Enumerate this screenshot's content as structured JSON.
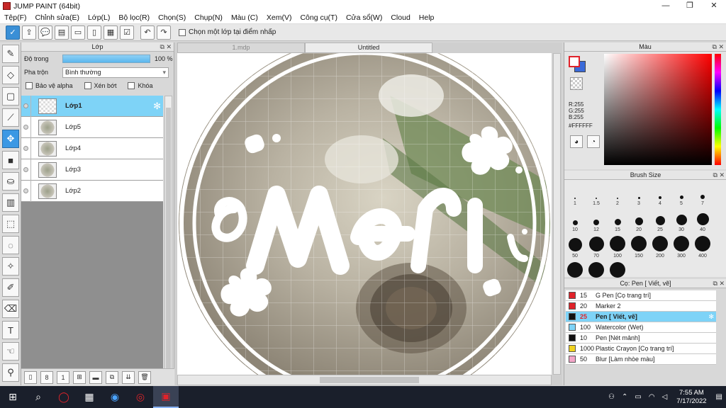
{
  "window": {
    "title": "JUMP PAINT (64bit)",
    "controls": [
      "—",
      "❐",
      "✕"
    ]
  },
  "menu": [
    "Tệp(F)",
    "Chỉnh sửa(E)",
    "Lớp(L)",
    "Bộ lọc(R)",
    "Chọn(S)",
    "Chụp(N)",
    "Màu (C)",
    "Xem(V)",
    "Công cụ(T)",
    "Cửa sổ(W)",
    "Cloud",
    "Help"
  ],
  "toolbar": {
    "select_label": "Chọn một lớp tại điểm nhấp"
  },
  "layer_panel": {
    "title": "Lớp",
    "opacity_label": "Độ trong",
    "opacity_value": "100 %",
    "opacity_fraction": 1.0,
    "blend_label": "Pha trộn",
    "blend_value": "Bình thường",
    "protect_alpha": "Bảo vệ alpha",
    "clip": "Xén bớt",
    "lock": "Khóa",
    "layers": [
      {
        "name": "Lớp1",
        "selected": true
      },
      {
        "name": "Lớp5",
        "selected": false
      },
      {
        "name": "Lớp4",
        "selected": false
      },
      {
        "name": "Lớp3",
        "selected": false
      },
      {
        "name": "Lớp2",
        "selected": false
      }
    ]
  },
  "tabs": [
    {
      "label": "1.mdp",
      "active": false
    },
    {
      "label": "Untitled",
      "active": true
    }
  ],
  "canvas": {
    "lettering": "Meri"
  },
  "color_panel": {
    "title": "Màu",
    "r": "R:255",
    "g": "G:255",
    "b": "B:255",
    "hex": "#FFFFFF",
    "foreground": "#ffffff",
    "background": "#3a6ad9"
  },
  "brush_size": {
    "title": "Brush Size",
    "sizes": [
      "1",
      "1.5",
      "2",
      "3",
      "4",
      "5",
      "7",
      "10",
      "12",
      "15",
      "20",
      "25",
      "30",
      "40",
      "50",
      "70",
      "100",
      "150",
      "200",
      "300",
      "400",
      "",
      "",
      ""
    ]
  },
  "pen_panel": {
    "title": "Cọ: Pen [ Viết, vẽ]",
    "items": [
      {
        "size": "15",
        "name": "G Pen [Cọ trang trí]",
        "color": "#e0232a"
      },
      {
        "size": "20",
        "name": "Marker 2",
        "color": "#e0232a"
      },
      {
        "size": "25",
        "name": "Pen [ Viết, vẽ]",
        "color": "#111111",
        "selected": true
      },
      {
        "size": "100",
        "name": "Watercolor (Wet)",
        "color": "#7ed3f7"
      },
      {
        "size": "10",
        "name": "Pen [Nét mảnh]",
        "color": "#111111"
      },
      {
        "size": "1000",
        "name": "Plastic Crayon [Cọ trang trí]",
        "color": "#f0d21e"
      },
      {
        "size": "50",
        "name": "Blur [Làm nhòe màu]",
        "color": "#f3a6c8"
      }
    ]
  },
  "taskbar": {
    "time": "7:55 AM",
    "date": "7/17/2022"
  }
}
